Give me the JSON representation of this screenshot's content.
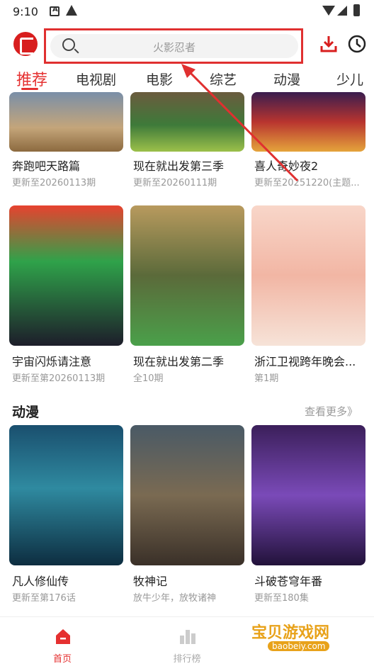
{
  "status_bar": {
    "time": "9:10",
    "icon_a": "A"
  },
  "search": {
    "placeholder": "火影忍者"
  },
  "tabs": [
    "推荐",
    "电视剧",
    "电影",
    "综艺",
    "动漫",
    "少儿"
  ],
  "row1": [
    {
      "title": "奔跑吧天路篇",
      "sub": "更新至20260113期"
    },
    {
      "title": "现在就出发第三季",
      "sub": "更新至20260111期"
    },
    {
      "title": "喜人奇妙夜2",
      "sub": "更新至20251220(主题..."
    }
  ],
  "row2": [
    {
      "title": "宇宙闪烁请注意",
      "sub": "更新至第20260113期"
    },
    {
      "title": "现在就出发第二季",
      "sub": "全10期"
    },
    {
      "title": "浙江卫视跨年晚会...",
      "sub": "第1期"
    }
  ],
  "anime_section": {
    "title": "动漫",
    "more": "查看更多》"
  },
  "row3": [
    {
      "title": "凡人修仙传",
      "sub": "更新至第176话"
    },
    {
      "title": "牧神记",
      "sub": "放牛少年，放牧诸神"
    },
    {
      "title": "斗破苍穹年番",
      "sub": "更新至180集"
    }
  ],
  "bottom_nav": {
    "home": "首页",
    "rank": "排行榜"
  },
  "watermark": {
    "title": "宝贝游戏网",
    "sub": "baobeiy.com"
  },
  "colors": {
    "accent": "#e53030",
    "muted": "#999999"
  },
  "icons": [
    "search-icon",
    "download-icon",
    "clock-icon",
    "home-icon",
    "rank-icon"
  ]
}
